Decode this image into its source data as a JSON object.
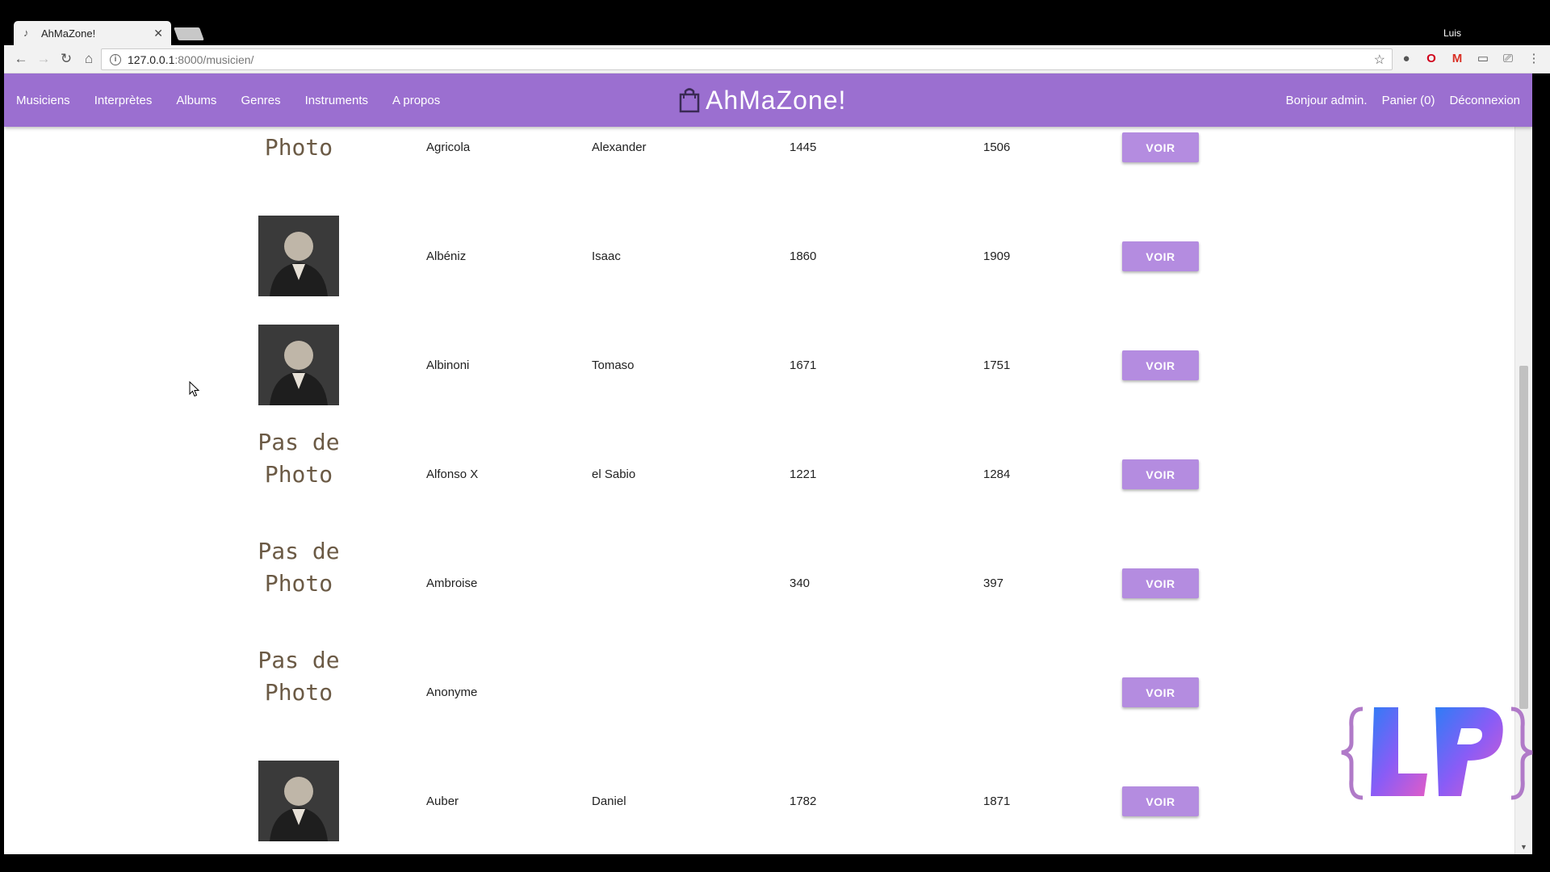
{
  "browser": {
    "tab_title": "AhMaZone!",
    "profile": "Luis",
    "url_host": "127.0.0.1",
    "url_path": ":8000/musicien/"
  },
  "site": {
    "brand": "AhMaZone!",
    "nav": [
      "Musiciens",
      "Interprètes",
      "Albums",
      "Genres",
      "Instruments",
      "A propos"
    ],
    "greeting": "Bonjour admin.",
    "cart": "Panier (0)",
    "logout": "Déconnexion",
    "accent_color": "#9b6fd0",
    "button_color": "#b48ce0"
  },
  "table": {
    "button_label": "VOIR",
    "no_photo_text": "Pas de Photo",
    "rows": [
      {
        "nom": "Agricola",
        "prenom": "Alexander",
        "naissance": "1445",
        "mort": "1506",
        "photo": false
      },
      {
        "nom": "Albéniz",
        "prenom": "Isaac",
        "naissance": "1860",
        "mort": "1909",
        "photo": true
      },
      {
        "nom": "Albinoni",
        "prenom": "Tomaso",
        "naissance": "1671",
        "mort": "1751",
        "photo": true
      },
      {
        "nom": "Alfonso X",
        "prenom": "el Sabio",
        "naissance": "1221",
        "mort": "1284",
        "photo": false
      },
      {
        "nom": "Ambroise",
        "prenom": "",
        "naissance": "340",
        "mort": "397",
        "photo": false
      },
      {
        "nom": "Anonyme",
        "prenom": "",
        "naissance": "",
        "mort": "",
        "photo": false
      },
      {
        "nom": "Auber",
        "prenom": "Daniel",
        "naissance": "1782",
        "mort": "1871",
        "photo": true
      }
    ]
  },
  "watermark": "{LP}"
}
